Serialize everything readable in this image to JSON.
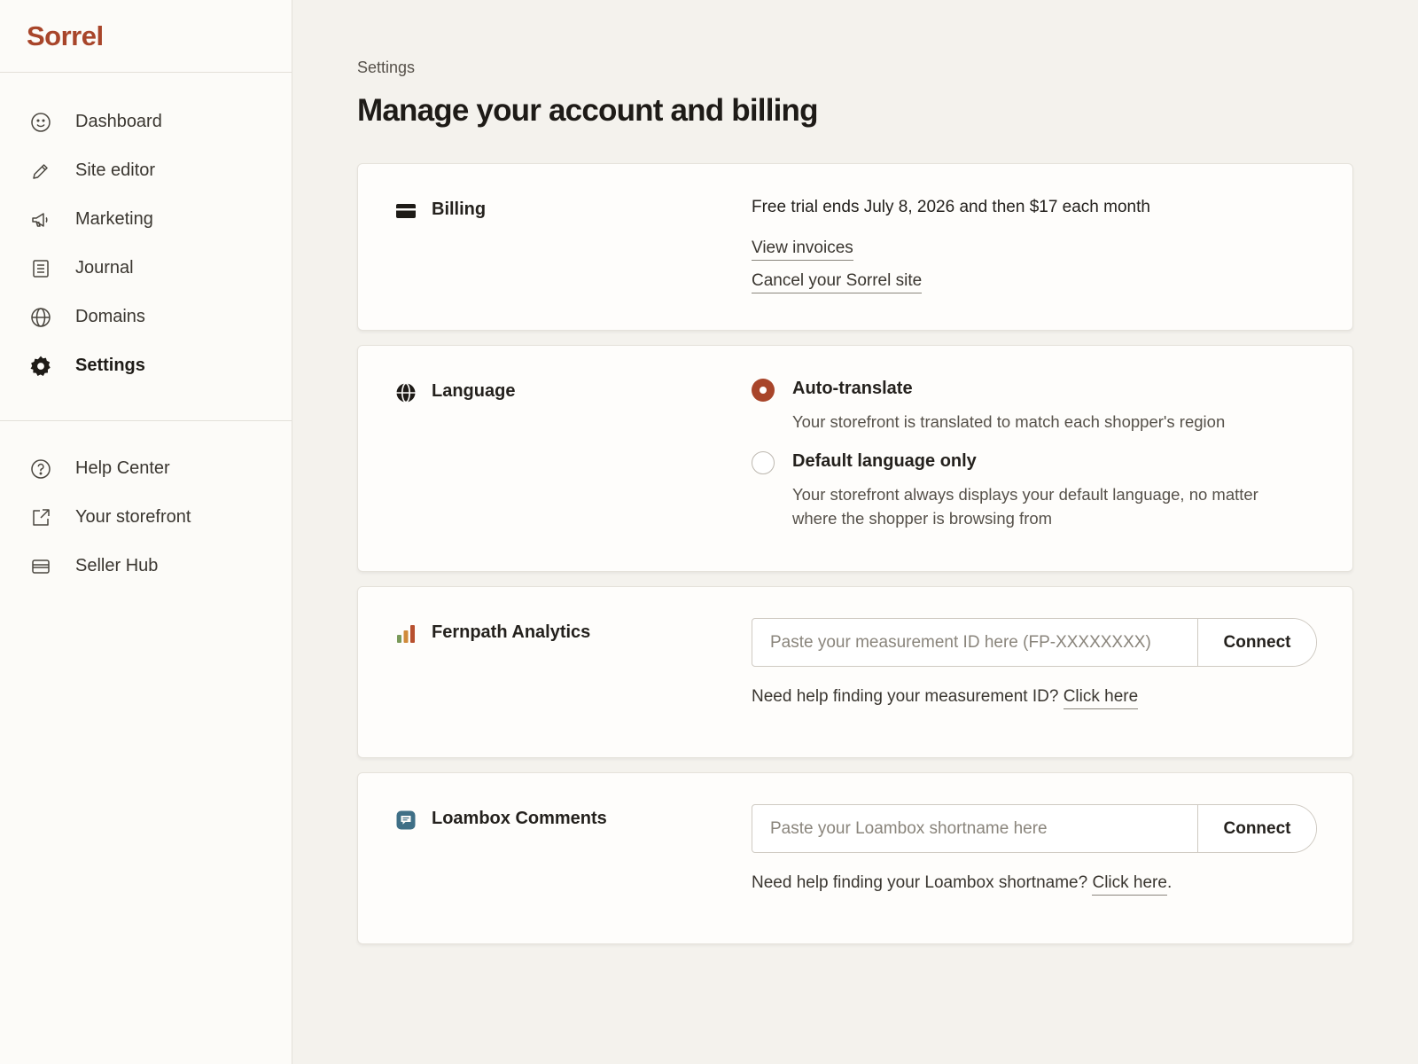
{
  "brand": {
    "name": "Sorrel",
    "color": "#a8452a"
  },
  "sidebar": {
    "primary": [
      {
        "label": "Dashboard",
        "icon": "smiley-icon"
      },
      {
        "label": "Site editor",
        "icon": "pencil-icon"
      },
      {
        "label": "Marketing",
        "icon": "megaphone-icon"
      },
      {
        "label": "Journal",
        "icon": "document-icon"
      },
      {
        "label": "Domains",
        "icon": "globe-icon"
      },
      {
        "label": "Settings",
        "icon": "gear-icon",
        "active": true
      }
    ],
    "secondary": [
      {
        "label": "Help Center",
        "icon": "question-icon"
      },
      {
        "label": "Your storefront",
        "icon": "external-link-icon"
      },
      {
        "label": "Seller Hub",
        "icon": "card-icon"
      }
    ]
  },
  "page": {
    "breadcrumb": "Settings",
    "title": "Manage your account and billing"
  },
  "billing": {
    "title": "Billing",
    "icon": "credit-card-icon",
    "status": "Free trial ends July 8, 2026 and then $17 each month",
    "links": [
      "View invoices",
      "Cancel your Sorrel site"
    ]
  },
  "language": {
    "title": "Language",
    "icon": "globe-icon",
    "options": [
      {
        "label": "Auto-translate",
        "description": "Your storefront is translated to match each shopper's region",
        "selected": true
      },
      {
        "label": "Default language only",
        "description": "Your storefront always displays your default language, no matter where the shopper is browsing from",
        "selected": false
      }
    ]
  },
  "analytics": {
    "title": "Fernpath Analytics",
    "icon": "bar-chart-icon",
    "placeholder": "Paste your measurement ID here (FP-XXXXXXXX)",
    "button": "Connect",
    "help_text": "Need help finding your measurement ID?",
    "help_link": "Click here",
    "help_suffix": ""
  },
  "comments": {
    "title": "Loambox Comments",
    "icon": "comment-bubble-icon",
    "placeholder": "Paste your Loambox shortname here",
    "button": "Connect",
    "help_text": "Need help finding your Loambox shortname?",
    "help_link": "Click here",
    "help_suffix": "."
  },
  "colors": {
    "accent": "#a8452a",
    "analytics_bars": [
      "#7a9a5a",
      "#d08a3a",
      "#b8502e"
    ],
    "comments_icon": "#3f6f86"
  }
}
